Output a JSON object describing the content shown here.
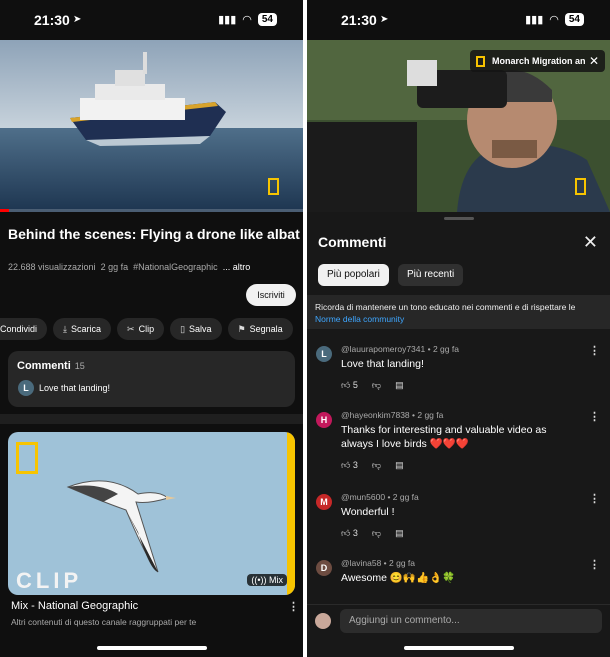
{
  "status": {
    "time": "21:30",
    "battery": "54"
  },
  "left": {
    "video_progress": 0.03,
    "title": "Behind the scenes: Flying a drone like albatross | Incredible Animal Journeys | Natio...",
    "views": "22.688 visualizzazioni",
    "date": "2 gg fa",
    "hashtag": "#NationalGeographic",
    "more": "... altro",
    "subscribe": "Iscriviti",
    "actions": [
      "Condividi",
      "Scarica",
      "Clip",
      "Salva",
      "Segnala"
    ],
    "comments": {
      "label": "Commenti",
      "count": "15",
      "preview_avatar": "L",
      "preview_text": "Love that landing!"
    },
    "mix": {
      "overlay": "CLIP",
      "badge": "Mix",
      "title": "Mix - National Geographic",
      "subtitle": "Altri contenuti di questo canale raggruppati per te"
    }
  },
  "right": {
    "pip_title": "Monarch Migration an",
    "sheet_title": "Commenti",
    "chips": [
      "Più popolari",
      "Più recenti"
    ],
    "notice_text": "Ricorda di mantenere un tono educato nei commenti e di rispettare le",
    "notice_link": "Norme della community",
    "comments": [
      {
        "avatar": "L",
        "color": "#4a6a7c",
        "author": "@lauurapomeroy7341",
        "time": "2 gg fa",
        "text": "Love that landing!",
        "likes": "5"
      },
      {
        "avatar": "H",
        "color": "#c2185b",
        "author": "@hayeonkim7838",
        "time": "2 gg fa",
        "text": "Thanks for interesting and valuable video as always I love birds ❤️❤️❤️",
        "likes": "3"
      },
      {
        "avatar": "M",
        "color": "#c62828",
        "author": "@mun5600",
        "time": "2 gg fa",
        "text": "Wonderful !",
        "likes": "3"
      },
      {
        "avatar": "D",
        "color": "#6d4c41",
        "author": "@lavina58",
        "time": "2 gg fa",
        "text": "Awesome 😊🙌👍👌🍀",
        "likes": ""
      }
    ],
    "add_placeholder": "Aggiungi un commento..."
  }
}
